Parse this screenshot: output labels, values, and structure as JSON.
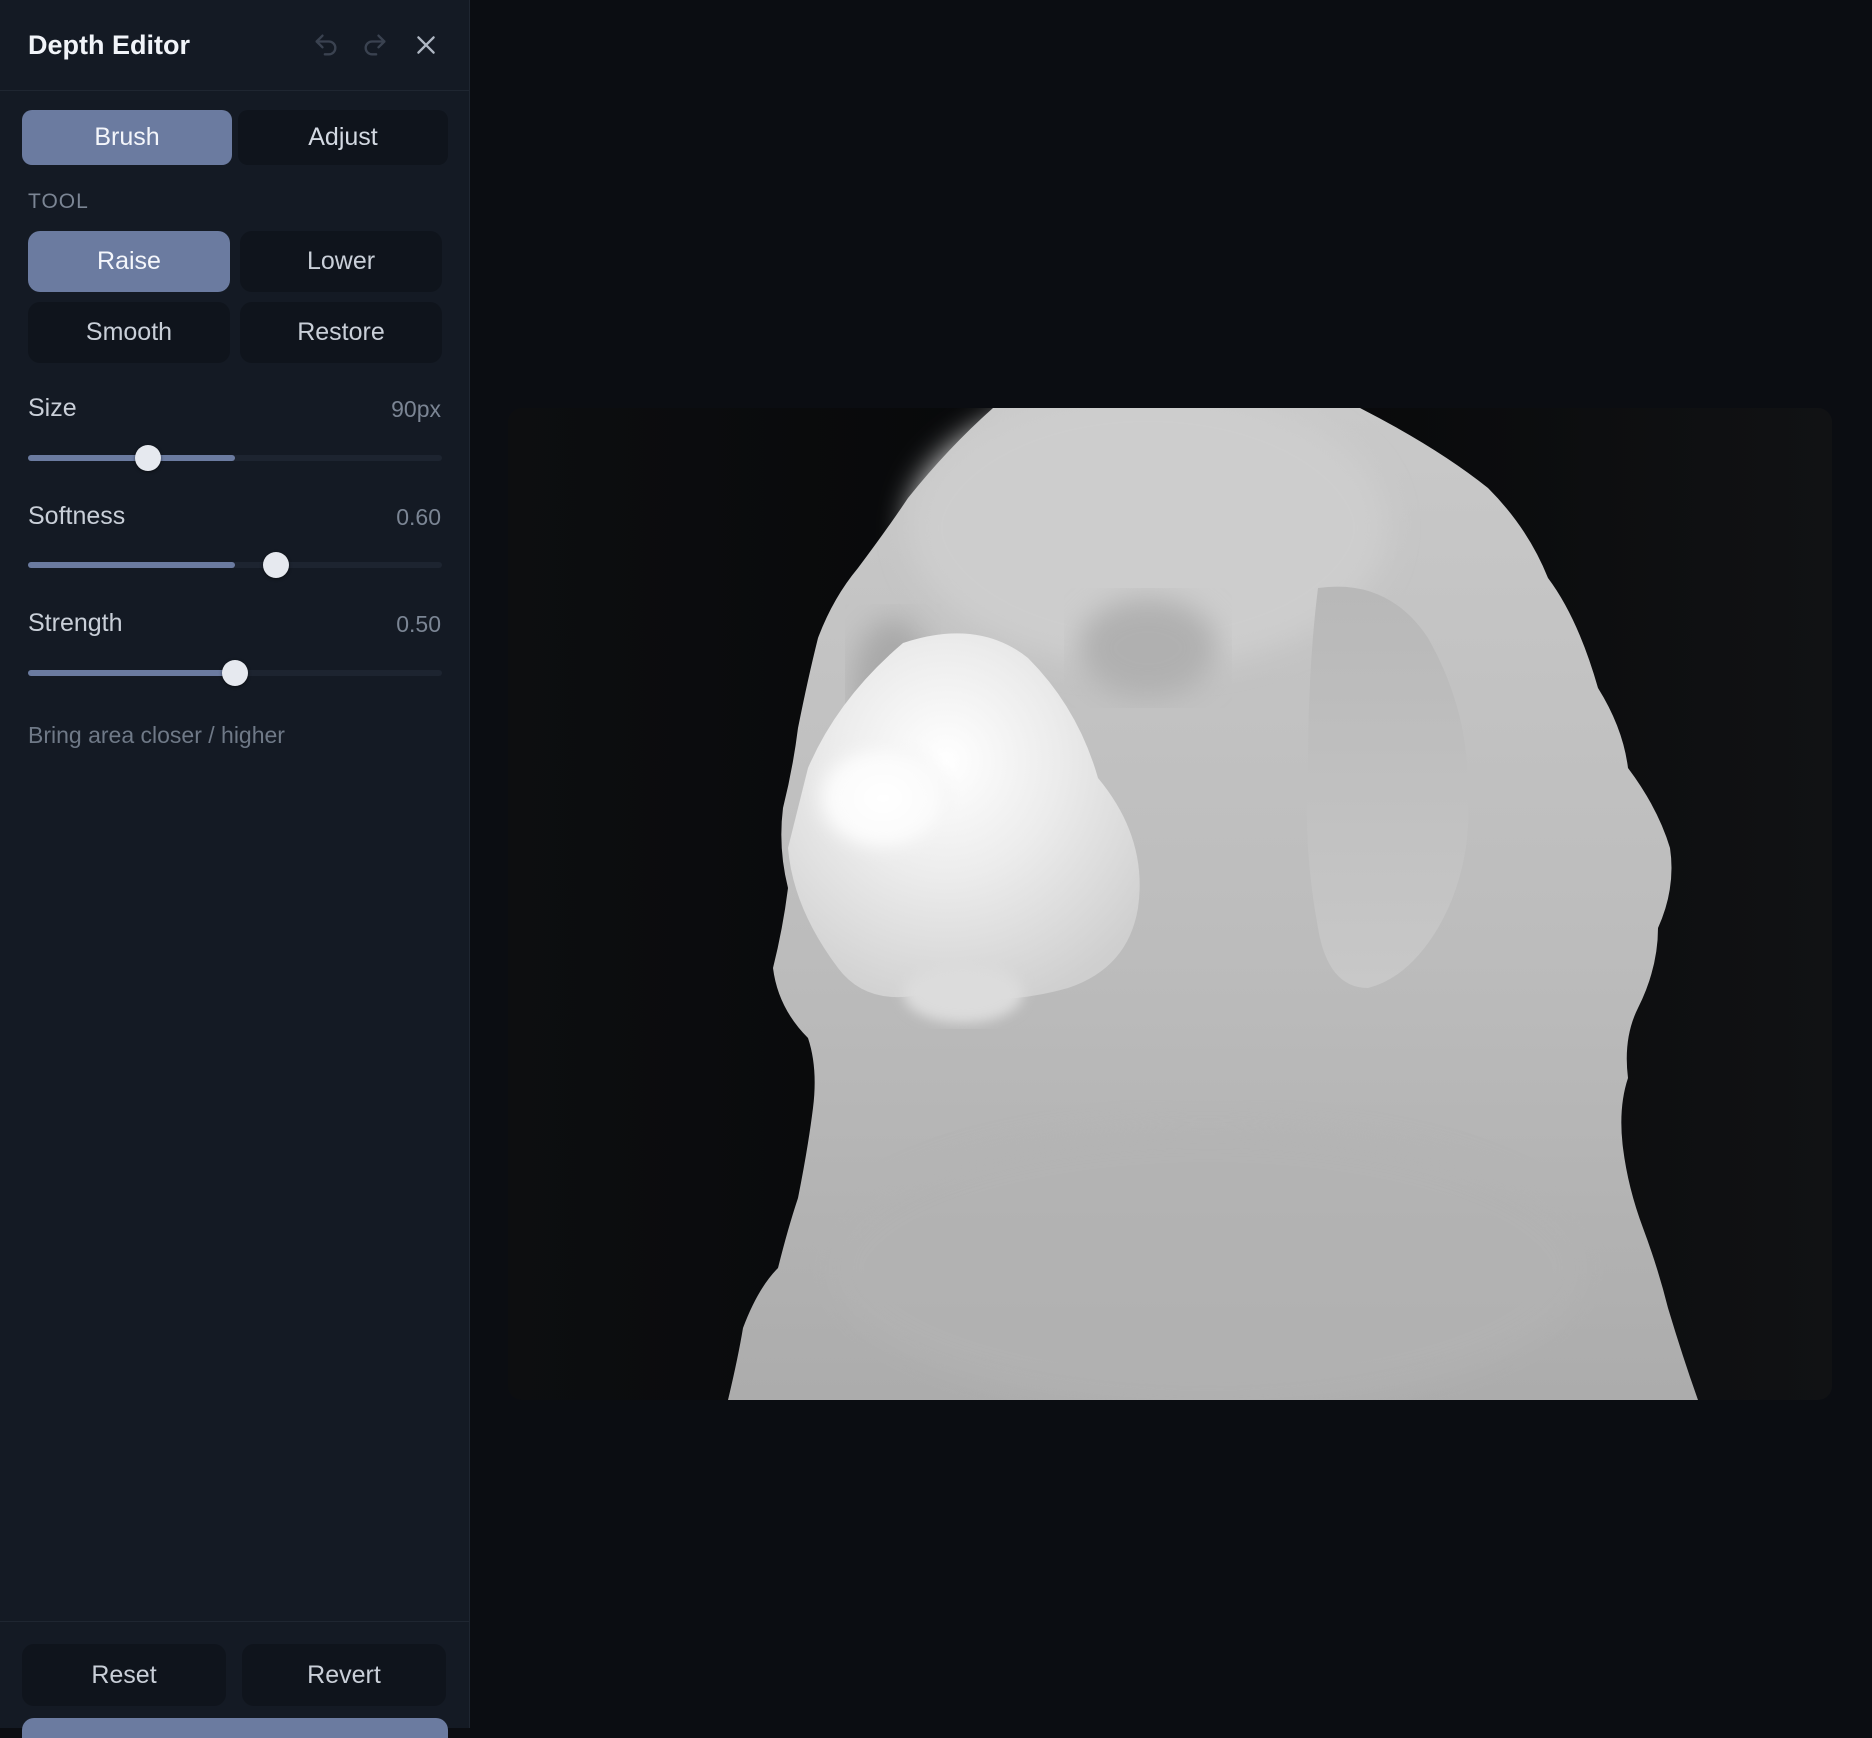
{
  "header": {
    "title": "Depth Editor"
  },
  "mode_tabs": [
    {
      "label": "Brush",
      "active": true
    },
    {
      "label": "Adjust",
      "active": false
    }
  ],
  "tool_section": {
    "label": "TOOL",
    "tools": [
      {
        "label": "Raise",
        "active": true
      },
      {
        "label": "Lower",
        "active": false
      },
      {
        "label": "Smooth",
        "active": false
      },
      {
        "label": "Restore",
        "active": false
      }
    ]
  },
  "sliders": [
    {
      "label": "Size",
      "value_text": "90px",
      "level": 0.29,
      "fill_level": 0.5
    },
    {
      "label": "Softness",
      "value_text": "0.60",
      "level": 0.6,
      "fill_level": 0.5
    },
    {
      "label": "Strength",
      "value_text": "0.50",
      "level": 0.5,
      "fill_level": 0.5
    }
  ],
  "tool_hint": "Bring area closer / higher",
  "footer": {
    "reset_label": "Reset",
    "revert_label": "Revert"
  },
  "colors": {
    "accent": "#6b7ba0",
    "sidebar_bg": "#141a24",
    "canvas_bg": "#0b0d12"
  },
  "icons": {
    "undo": "undo-icon",
    "redo": "redo-icon",
    "close": "close-icon"
  }
}
